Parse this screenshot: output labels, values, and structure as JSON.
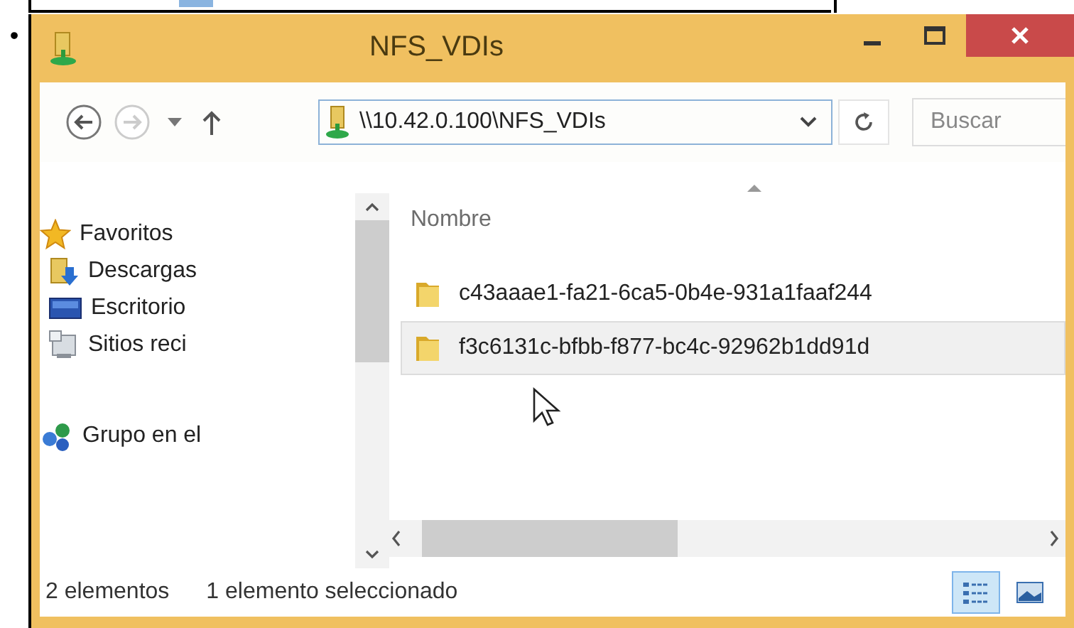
{
  "bullet": "•",
  "window": {
    "title": "NFS_VDIs"
  },
  "address": {
    "value": "\\\\10.42.0.100\\NFS_VDIs"
  },
  "search": {
    "placeholder": "Buscar"
  },
  "sidebar": {
    "items": [
      {
        "kind": "favorites",
        "label": "Favoritos"
      },
      {
        "kind": "downloads",
        "label": "Descargas"
      },
      {
        "kind": "desktop",
        "label": "Escritorio"
      },
      {
        "kind": "recent",
        "label": "Sitios reci"
      },
      {
        "kind": "homegroup",
        "label": "Grupo en el"
      }
    ]
  },
  "table": {
    "columns": [
      "Nombre"
    ],
    "rows": [
      {
        "name": "c43aaae1-fa21-6ca5-0b4e-931a1faaf244",
        "selected": false
      },
      {
        "name": "f3c6131c-bfbb-f877-bc4c-92962b1dd91d",
        "selected": true
      }
    ]
  },
  "status_bar": {
    "count": "2 elementos",
    "selection": "1 elemento seleccionado"
  },
  "view_buttons": [
    {
      "kind": "details",
      "selected": true
    },
    {
      "kind": "thumbnails",
      "selected": false
    }
  ]
}
